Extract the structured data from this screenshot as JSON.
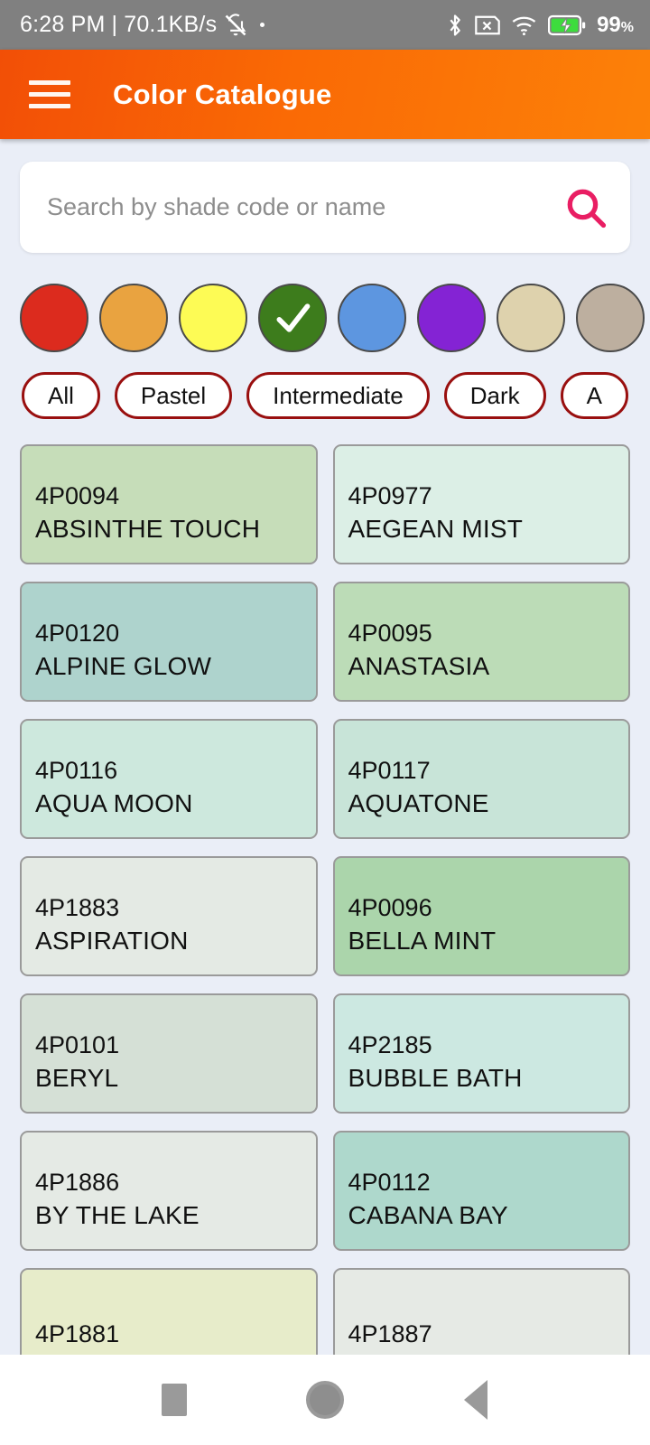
{
  "status_bar": {
    "time": "6:28 PM",
    "separator": "|",
    "network_speed": "70.1KB/s",
    "mute_icon": "bell-muted-icon",
    "dot_icon": "dot-icon",
    "bluetooth_icon": "bluetooth-icon",
    "sim_icon": "sim-card-missing-icon",
    "wifi_icon": "wifi-icon",
    "battery_icon": "battery-charging-icon",
    "battery_level": "99",
    "battery_unit": "%"
  },
  "app_bar": {
    "menu_icon": "hamburger-menu-icon",
    "title": "Color Catalogue",
    "gradient_start": "#f24f06",
    "gradient_end": "#fc8108"
  },
  "search": {
    "placeholder": "Search by shade code or name",
    "value": "",
    "icon": "search-icon",
    "icon_color": "#e91e63"
  },
  "color_circles": {
    "selected_index": 3,
    "check_icon": "check-icon",
    "items": [
      {
        "name": "red",
        "hex": "#dc2b1e",
        "selected": false
      },
      {
        "name": "orange",
        "hex": "#e9a340",
        "selected": false
      },
      {
        "name": "yellow",
        "hex": "#fdfb55",
        "selected": false
      },
      {
        "name": "green",
        "hex": "#3d7c1c",
        "selected": true
      },
      {
        "name": "blue",
        "hex": "#5d96e0",
        "selected": false
      },
      {
        "name": "purple",
        "hex": "#8423d4",
        "selected": false
      },
      {
        "name": "beige",
        "hex": "#ded2ad",
        "selected": false
      },
      {
        "name": "taupe",
        "hex": "#bdaf9f",
        "selected": false
      }
    ]
  },
  "filter_chips": {
    "border_color": "#990f0f",
    "items": [
      {
        "label": "All",
        "selected": false
      },
      {
        "label": "Pastel",
        "selected": false
      },
      {
        "label": "Intermediate",
        "selected": false
      },
      {
        "label": "Dark",
        "selected": false
      },
      {
        "label": "A",
        "selected": false,
        "truncated": true
      }
    ]
  },
  "color_grid": {
    "cards": [
      {
        "code": "4P0094",
        "name": "ABSINTHE TOUCH",
        "hex": "#c6ddb9"
      },
      {
        "code": "4P0977",
        "name": "AEGEAN MIST",
        "hex": "#dcefe6"
      },
      {
        "code": "4P0120",
        "name": "ALPINE GLOW",
        "hex": "#aed3cd"
      },
      {
        "code": "4P0095",
        "name": "ANASTASIA",
        "hex": "#bcdcb7"
      },
      {
        "code": "4P0116",
        "name": "AQUA MOON",
        "hex": "#cde8dd"
      },
      {
        "code": "4P0117",
        "name": "AQUATONE",
        "hex": "#c8e4d8"
      },
      {
        "code": "4P1883",
        "name": "ASPIRATION",
        "hex": "#e4eae4"
      },
      {
        "code": "4P0096",
        "name": "BELLA MINT",
        "hex": "#abd5ab"
      },
      {
        "code": "4P0101",
        "name": "BERYL",
        "hex": "#d5e0d6"
      },
      {
        "code": "4P2185",
        "name": "BUBBLE BATH",
        "hex": "#cce8e1"
      },
      {
        "code": "4P1886",
        "name": "BY THE LAKE",
        "hex": "#e5eae5"
      },
      {
        "code": "4P0112",
        "name": "CABANA BAY",
        "hex": "#aed8cc"
      },
      {
        "code": "4P1881",
        "name": "",
        "hex": "#e7ecca"
      },
      {
        "code": "4P1887",
        "name": "",
        "hex": "#e6eae5"
      }
    ]
  },
  "nav_bar": {
    "recents_icon": "square-recents-icon",
    "home_icon": "circle-home-icon",
    "back_icon": "triangle-back-icon"
  }
}
